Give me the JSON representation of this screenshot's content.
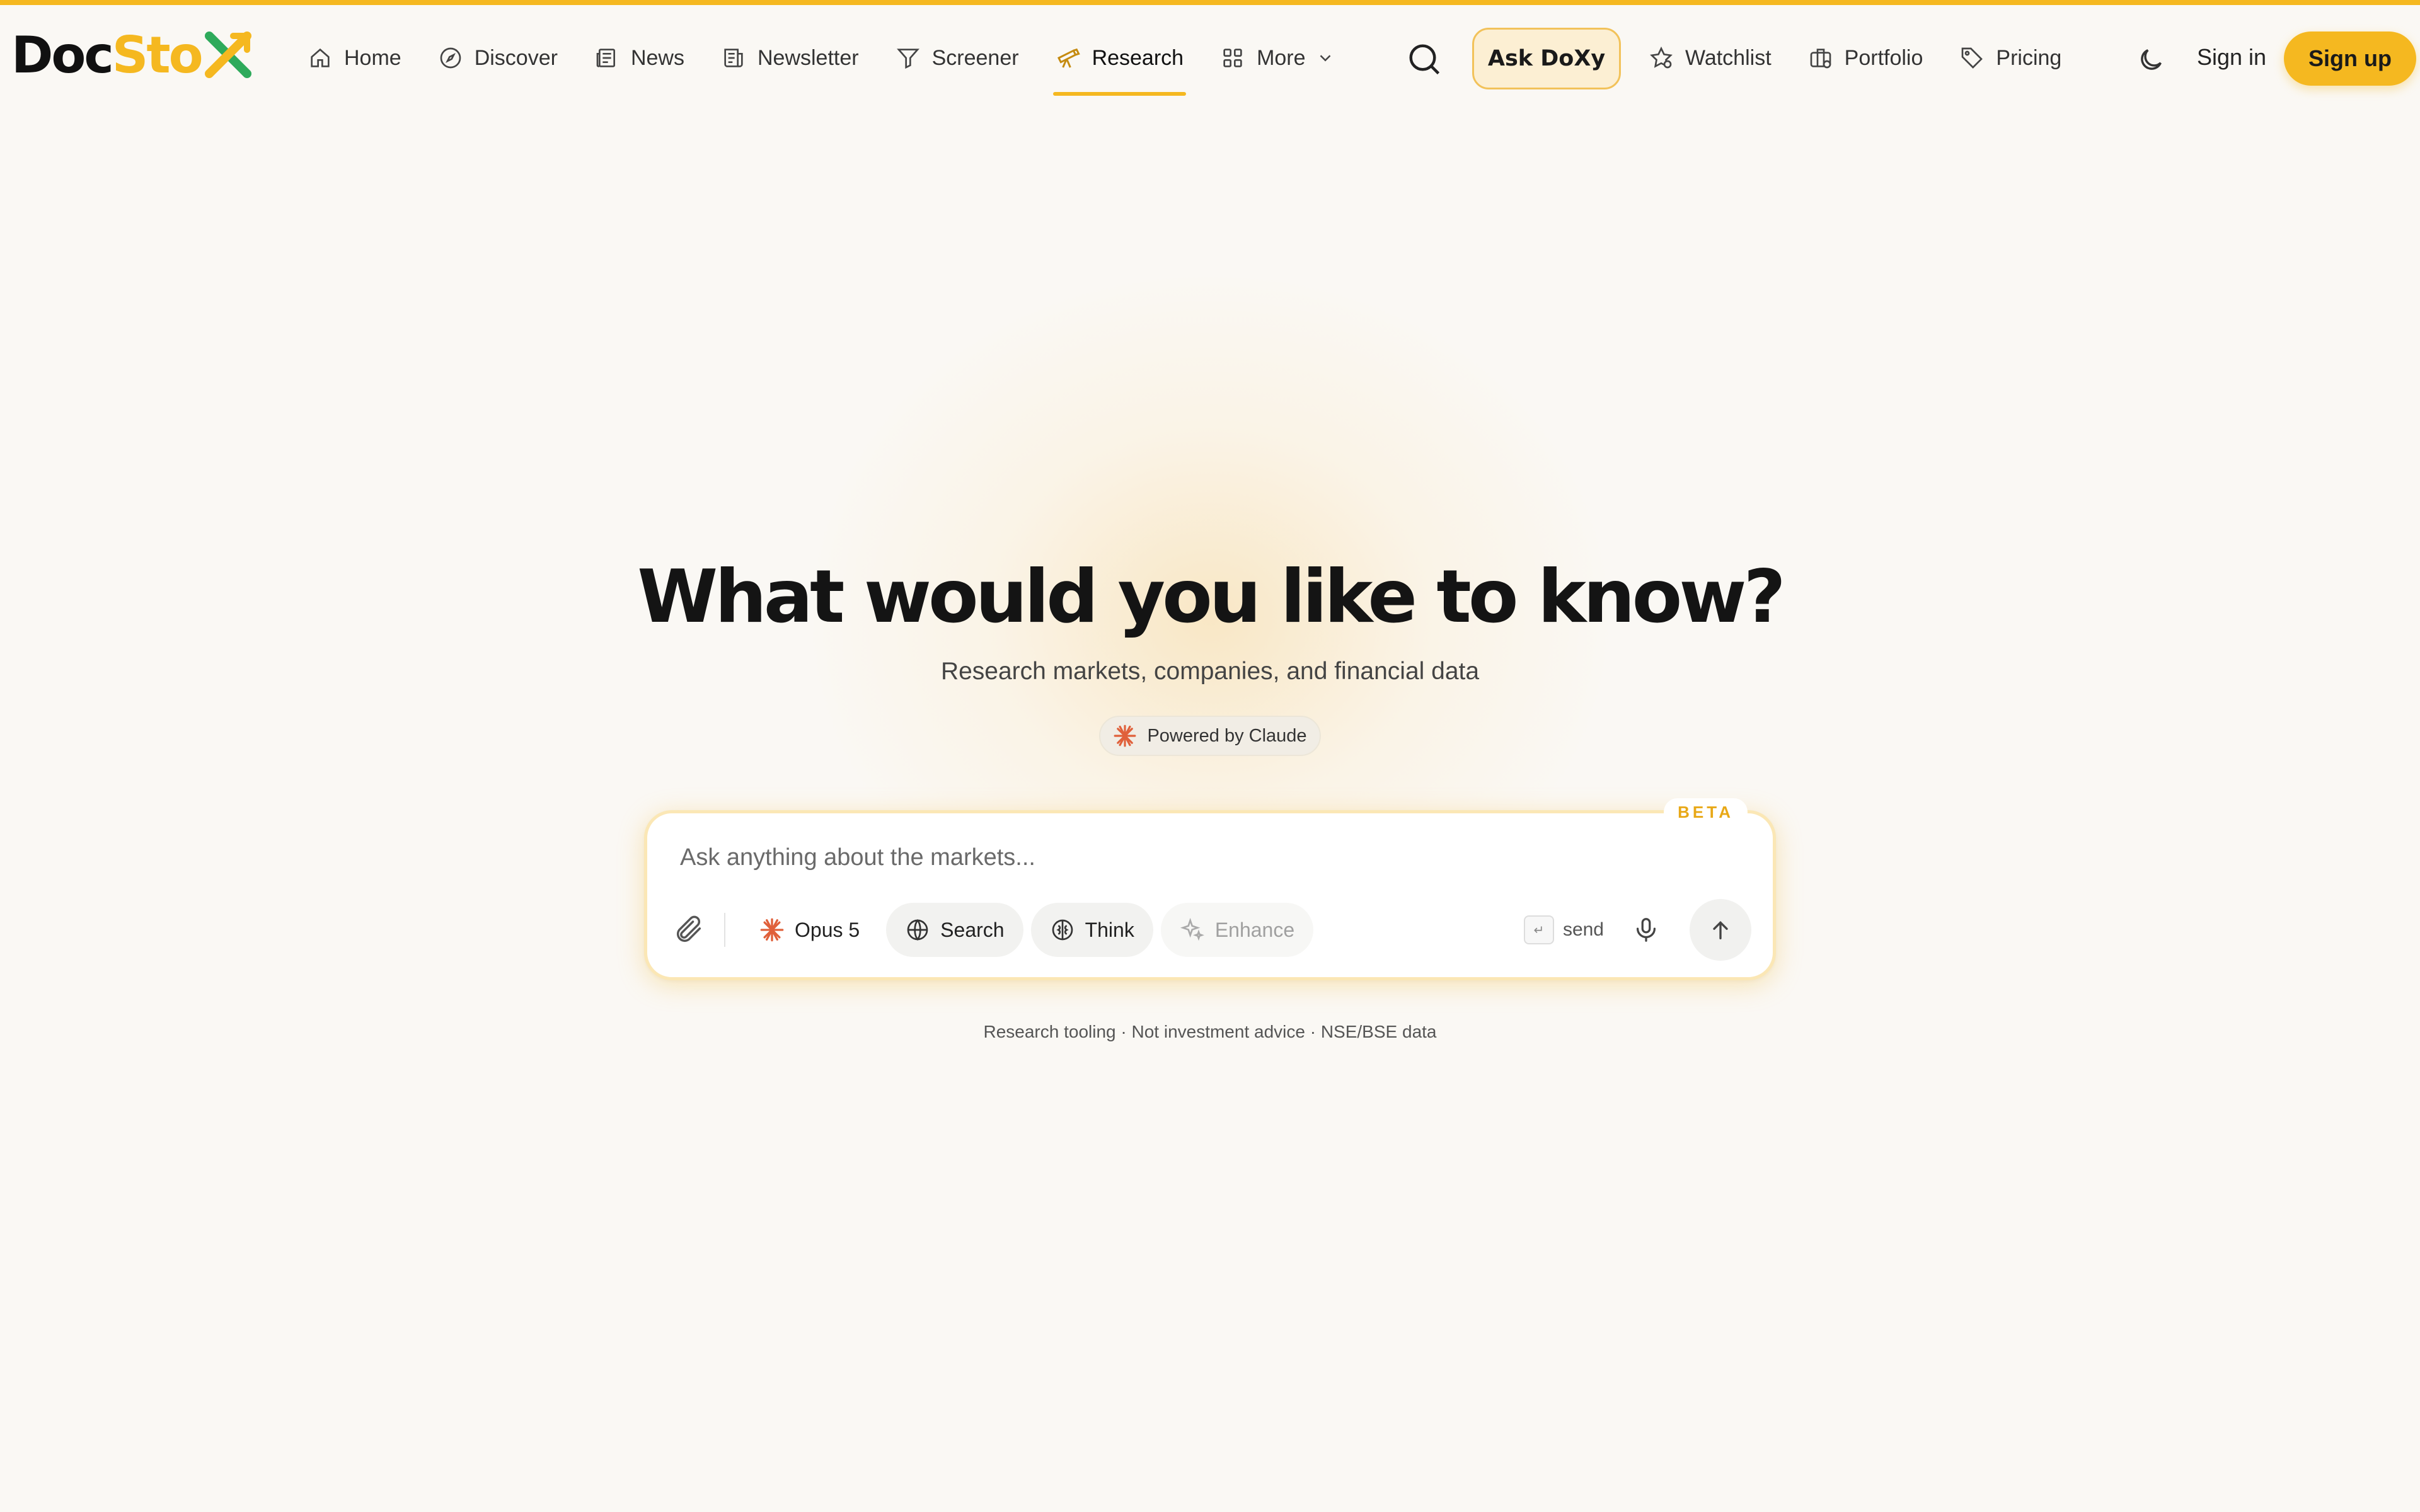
{
  "brand": {
    "part1": "Doc",
    "part2": "Sto",
    "part3": "X",
    "accent": "#f5b820",
    "x_green": "#2eaa5b"
  },
  "nav": {
    "items": [
      {
        "label": "Home",
        "icon": "home-icon"
      },
      {
        "label": "Discover",
        "icon": "compass-icon"
      },
      {
        "label": "News",
        "icon": "newspaper-icon"
      },
      {
        "label": "Newsletter",
        "icon": "newsletter-icon"
      },
      {
        "label": "Screener",
        "icon": "filter-icon"
      },
      {
        "label": "Research",
        "icon": "telescope-icon",
        "active": true
      },
      {
        "label": "More",
        "icon": "grid-icon"
      }
    ]
  },
  "header": {
    "ask_label": "Ask DoXy",
    "right_items": [
      {
        "label": "Watchlist",
        "icon": "star-icon"
      },
      {
        "label": "Portfolio",
        "icon": "briefcase-icon"
      },
      {
        "label": "Pricing",
        "icon": "tag-icon"
      }
    ],
    "signin_label": "Sign in",
    "signup_label": "Sign up"
  },
  "hero": {
    "title": "What would you like to know?",
    "subtitle": "Research markets, companies, and financial data",
    "powered_by": "Powered by Claude"
  },
  "chat": {
    "badge": "BETA",
    "placeholder": "Ask anything about the markets...",
    "model_label": "Opus 5",
    "search_label": "Search",
    "think_label": "Think",
    "enhance_label": "Enhance",
    "enter_key": "↵",
    "send_label": "send"
  },
  "footer": {
    "note": "Research tooling · Not investment advice · NSE/BSE data"
  }
}
